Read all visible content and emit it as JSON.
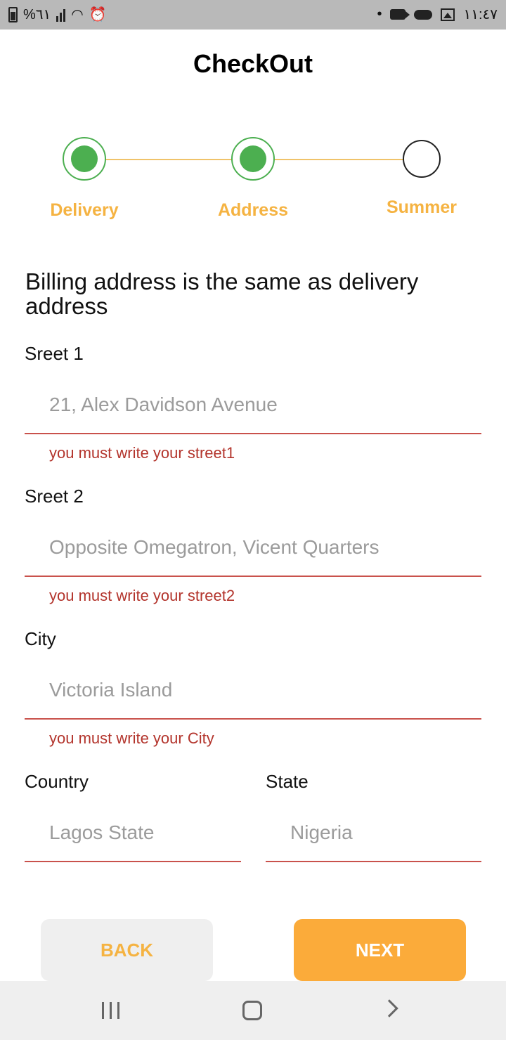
{
  "status_bar": {
    "battery_percent": "%٦١",
    "time": "١١:٤٧",
    "dot": "•"
  },
  "title": "CheckOut",
  "stepper": {
    "steps": [
      {
        "label": "Delivery",
        "state": "done"
      },
      {
        "label": "Address",
        "state": "done"
      },
      {
        "label": "Summer",
        "state": "todo"
      }
    ],
    "done_color": "#4caf50",
    "label_color": "#f5b342",
    "line_color": "#f0c36a"
  },
  "headline": "Billing address is the same as delivery address",
  "fields": {
    "street1": {
      "label": "Sreet 1",
      "value": "21, Alex Davidson Avenue",
      "error": "you must  write your street1"
    },
    "street2": {
      "label": "Sreet 2",
      "value": "Opposite Omegatron, Vicent Quarters",
      "error": "you must  write your street2"
    },
    "city": {
      "label": "City",
      "value": "Victoria Island",
      "error": "you must  write your City"
    },
    "country": {
      "label": "Country",
      "value": "Lagos State"
    },
    "state": {
      "label": "State",
      "value": "Nigeria"
    }
  },
  "buttons": {
    "back": "BACK",
    "next": "NEXT"
  },
  "colors": {
    "accent": "#fbab3a",
    "error": "#b3342c",
    "underline": "#c9524c"
  }
}
